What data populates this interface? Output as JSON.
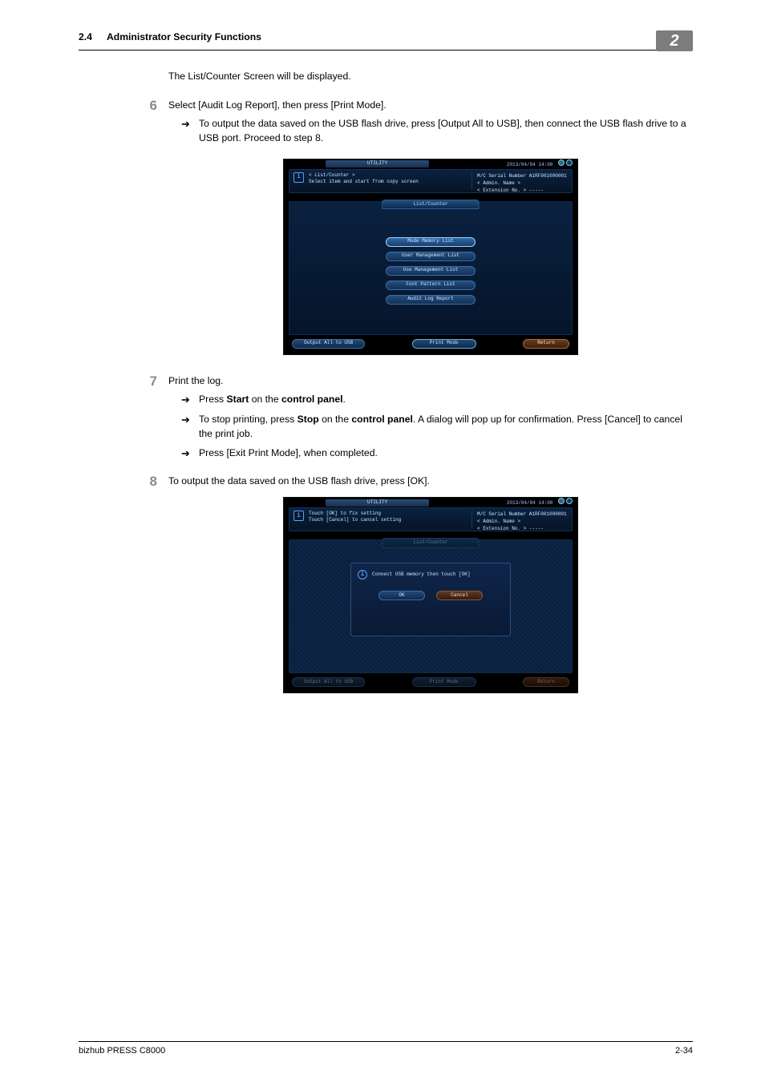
{
  "header": {
    "section_number": "2.4",
    "section_title": "Administrator Security Functions",
    "chapter_badge": "2"
  },
  "intro_text": "The List/Counter Screen will be displayed.",
  "steps": {
    "s6": {
      "num": "6",
      "text": "Select [Audit Log Report], then press [Print Mode].",
      "subs": [
        "To output the data saved on the USB flash drive, press [Output All to USB], then connect the USB flash drive to a USB port. Proceed to step 8."
      ]
    },
    "s7": {
      "num": "7",
      "text": "Print the log.",
      "subs_plain": [
        "Press [Exit Print Mode], when completed."
      ],
      "sub_start_pre": "Press ",
      "sub_start_b1": "Start",
      "sub_start_mid": " on the ",
      "sub_start_b2": "control panel",
      "sub_start_post": ".",
      "sub_stop_pre": "To stop printing, press ",
      "sub_stop_b1": "Stop",
      "sub_stop_mid": " on the ",
      "sub_stop_b2": "control panel",
      "sub_stop_post": ". A dialog will pop up for confirmation. Press [Cancel] to cancel the print job."
    },
    "s8": {
      "num": "8",
      "text": "To output the data saved on the USB flash drive, press [OK]."
    }
  },
  "screen1": {
    "utility": "UTILITY",
    "datetime": "2013/04/04 14:00",
    "info_left": "< List/Counter >\nSelect item and start from copy screen",
    "info_right": "M/C Serial Number  A1RF001000001\n< Admin. Name >\n< Extension No. >  -----",
    "tab": "List/Counter",
    "buttons": [
      "Mode Memory List",
      "User Management List",
      "Use Management List",
      "Font Pattern List",
      "Audit Log Report"
    ],
    "bottom_left": "Output All to USB",
    "bottom_center": "Print Mode",
    "bottom_right": "Return"
  },
  "screen2": {
    "utility": "UTILITY",
    "datetime": "2013/04/04 14:00",
    "info_left": "Touch [OK] to fix setting\nTouch [Cancel] to cancel setting",
    "info_right": "M/C Serial Number  A1RF001000001\n< Admin. Name >\n< Extension No. >  -----",
    "tab": "List/Counter",
    "dialog_msg": "Connect USB memory then touch [OK]",
    "ok": "OK",
    "cancel": "Cancel",
    "bottom_left": "Output All to USB",
    "bottom_center": "Print Mode",
    "bottom_right": "Return"
  },
  "footer": {
    "left": "bizhub PRESS C8000",
    "right": "2-34"
  }
}
